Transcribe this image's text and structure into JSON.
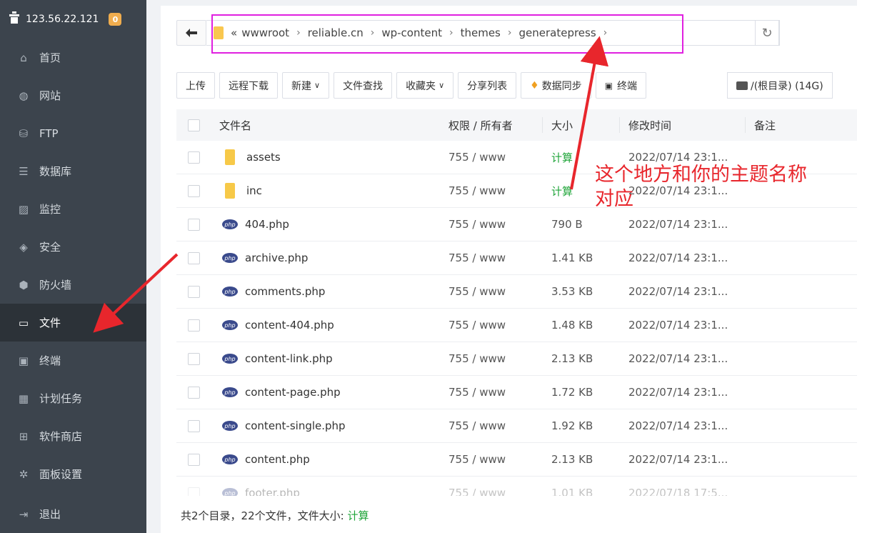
{
  "sidebar": {
    "server_ip": "123.56.22.121",
    "badge_count": "0",
    "items": [
      {
        "label": "首页",
        "icon": "home-icon"
      },
      {
        "label": "网站",
        "icon": "globe-icon"
      },
      {
        "label": "FTP",
        "icon": "ftp-icon"
      },
      {
        "label": "数据库",
        "icon": "database-icon"
      },
      {
        "label": "监控",
        "icon": "monitor-icon"
      },
      {
        "label": "安全",
        "icon": "shield-check-icon"
      },
      {
        "label": "防火墙",
        "icon": "firewall-icon"
      },
      {
        "label": "文件",
        "icon": "folder-icon"
      },
      {
        "label": "终端",
        "icon": "terminal-icon"
      },
      {
        "label": "计划任务",
        "icon": "calendar-icon"
      },
      {
        "label": "软件商店",
        "icon": "apps-icon"
      },
      {
        "label": "面板设置",
        "icon": "gear-icon"
      },
      {
        "label": "退出",
        "icon": "logout-icon"
      }
    ]
  },
  "path": {
    "prefix": "«",
    "crumbs": [
      "wwwroot",
      "reliable.cn",
      "wp-content",
      "themes",
      "generatepress"
    ],
    "separator": "›"
  },
  "toolbar": {
    "upload": "上传",
    "remote_download": "远程下载",
    "new": "新建",
    "file_search": "文件查找",
    "favorites": "收藏夹",
    "share_list": "分享列表",
    "data_sync": "数据同步",
    "terminal": "终端",
    "disk": "/(根目录) (14G)"
  },
  "table": {
    "headers": {
      "name": "文件名",
      "perm": "权限 / 所有者",
      "size": "大小",
      "mtime": "修改时间",
      "note": "备注"
    },
    "rows": [
      {
        "name": "assets",
        "type": "folder",
        "perm": "755 / www",
        "size": "计算",
        "mtime": "2022/07/14 23:1..."
      },
      {
        "name": "inc",
        "type": "folder",
        "perm": "755 / www",
        "size": "计算",
        "mtime": "2022/07/14 23:1..."
      },
      {
        "name": "404.php",
        "type": "php",
        "perm": "755 / www",
        "size": "790 B",
        "mtime": "2022/07/14 23:1..."
      },
      {
        "name": "archive.php",
        "type": "php",
        "perm": "755 / www",
        "size": "1.41 KB",
        "mtime": "2022/07/14 23:1..."
      },
      {
        "name": "comments.php",
        "type": "php",
        "perm": "755 / www",
        "size": "3.53 KB",
        "mtime": "2022/07/14 23:1..."
      },
      {
        "name": "content-404.php",
        "type": "php",
        "perm": "755 / www",
        "size": "1.48 KB",
        "mtime": "2022/07/14 23:1..."
      },
      {
        "name": "content-link.php",
        "type": "php",
        "perm": "755 / www",
        "size": "2.13 KB",
        "mtime": "2022/07/14 23:1..."
      },
      {
        "name": "content-page.php",
        "type": "php",
        "perm": "755 / www",
        "size": "1.72 KB",
        "mtime": "2022/07/14 23:1..."
      },
      {
        "name": "content-single.php",
        "type": "php",
        "perm": "755 / www",
        "size": "1.92 KB",
        "mtime": "2022/07/14 23:1..."
      },
      {
        "name": "content.php",
        "type": "php",
        "perm": "755 / www",
        "size": "2.13 KB",
        "mtime": "2022/07/14 23:1..."
      },
      {
        "name": "footer.php",
        "type": "php",
        "perm": "755 / www",
        "size": "1.01 KB",
        "mtime": "2022/07/18 17:5..."
      }
    ]
  },
  "footer": {
    "summary": "共2个目录，22个文件，文件大小:",
    "calc": "计算"
  },
  "annotation": {
    "line1": "这个地方和你的主题名称",
    "line2": "对应"
  },
  "colors": {
    "sidebar_bg": "#3c444d",
    "accent_green": "#20a53a",
    "annotation_red": "#e8262c",
    "highlight_magenta": "#e020e0",
    "badge_orange": "#f0ad4e"
  }
}
